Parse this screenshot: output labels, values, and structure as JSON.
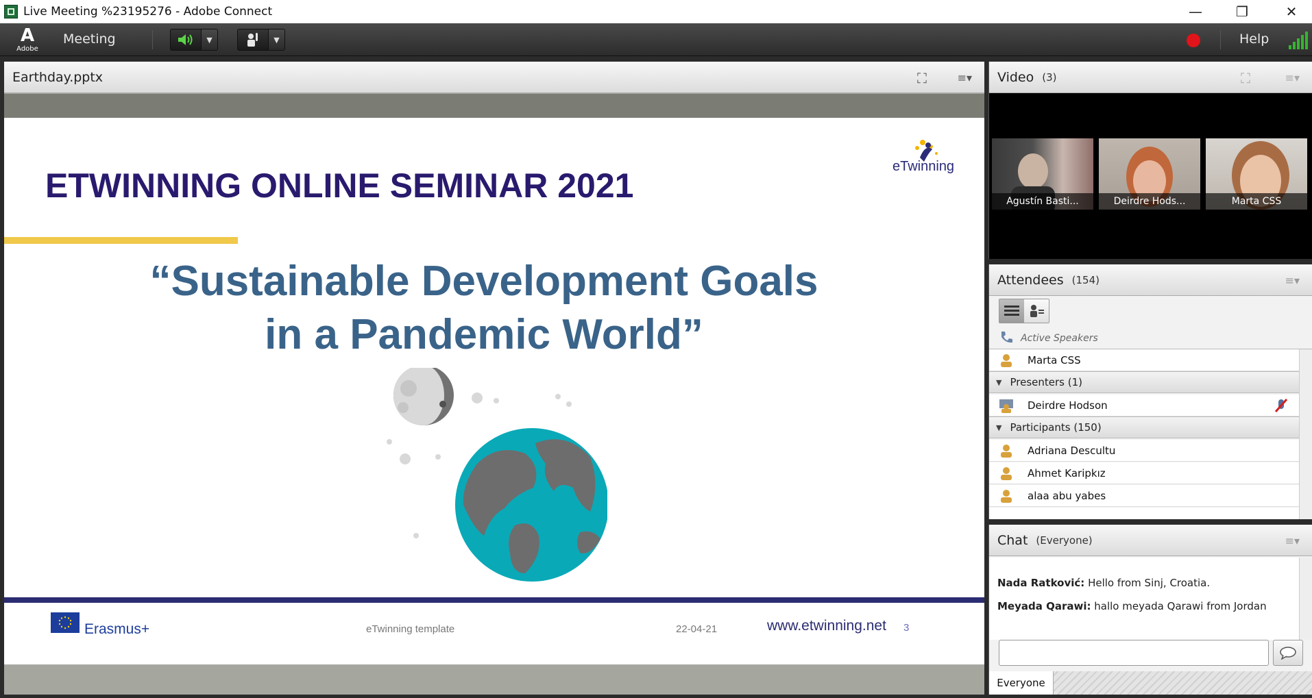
{
  "window": {
    "title": "Live Meeting %23195276 - Adobe Connect"
  },
  "toolbar": {
    "adobe_logo": "Adobe",
    "menu_meeting": "Meeting",
    "help": "Help",
    "record_color": "#e0141a",
    "signal_color": "#35b52f"
  },
  "share": {
    "file_name": "Earthday.pptx",
    "slide": {
      "title": "ETWINNING ONLINE SEMINAR 2021",
      "subtitle_line1": "“Sustainable Development Goals",
      "subtitle_line2": "in a Pandemic World”",
      "logo_text": "eTwinning",
      "erasmus": "Erasmus+",
      "template": "eTwinning template",
      "date": "22-04-21",
      "url": "www.etwinning.net",
      "page_number": "3"
    }
  },
  "video": {
    "title": "Video",
    "count": "(3)",
    "thumbs": [
      {
        "name": "Agustín Basti..."
      },
      {
        "name": "Deirdre Hods..."
      },
      {
        "name": "Marta CSS"
      }
    ]
  },
  "attendees": {
    "title": "Attendees",
    "count": "(154)",
    "active_speakers_label": "Active Speakers",
    "active_speakers": [
      "Marta CSS"
    ],
    "presenters_label": "Presenters (1)",
    "presenters": [
      "Deirdre Hodson"
    ],
    "participants_label": "Participants (150)",
    "participants": [
      "Adriana Descultu",
      "Ahmet Karipkız",
      "alaa abu yabes"
    ]
  },
  "chat": {
    "title": "Chat",
    "audience": "(Everyone)",
    "messages": [
      {
        "sender": "Nada Ratković:",
        "text": "Hello from Sinj, Croatia."
      },
      {
        "sender": "Meyada Qarawi:",
        "text": "hallo meyada Qarawi from Jordan"
      }
    ],
    "tab": "Everyone"
  }
}
